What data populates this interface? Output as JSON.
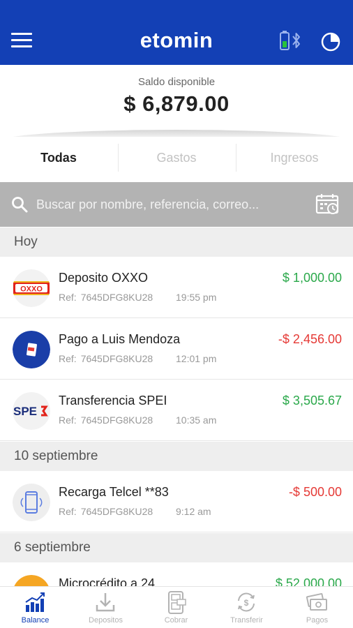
{
  "app": {
    "logo_text": "etomin"
  },
  "balance": {
    "label": "Saldo disponible",
    "value": "$ 6,879.00"
  },
  "tabs": [
    {
      "label": "Todas",
      "active": true
    },
    {
      "label": "Gastos",
      "active": false
    },
    {
      "label": "Ingresos",
      "active": false
    }
  ],
  "search": {
    "placeholder": "Buscar por nombre, referencia, correo..."
  },
  "sections": [
    {
      "header": "Hoy",
      "transactions": [
        {
          "name": "Deposito OXXO",
          "ref_label": "Ref:",
          "ref": "7645DFG8KU28",
          "time": "19:55 pm",
          "amount": "$ 1,000.00",
          "type": "positive",
          "icon": "oxxo-logo"
        },
        {
          "name": "Pago a Luis Mendoza",
          "ref_label": "Ref:",
          "ref": "7645DFG8KU28",
          "time": "12:01 pm",
          "amount": "-$ 2,456.00",
          "type": "negative",
          "icon": "card-icon"
        },
        {
          "name": "Transferencia SPEI",
          "ref_label": "Ref:",
          "ref": "7645DFG8KU28",
          "time": "10:35 am",
          "amount": "$ 3,505.67",
          "type": "positive",
          "icon": "spei-logo"
        }
      ]
    },
    {
      "header": "10 septiembre",
      "transactions": [
        {
          "name": "Recarga Telcel  **83",
          "ref_label": "Ref:",
          "ref": "7645DFG8KU28",
          "time": "9:12 am",
          "amount": "-$ 500.00",
          "type": "negative",
          "icon": "phone-icon"
        }
      ]
    },
    {
      "header": "6 septiembre",
      "transactions": [
        {
          "name": "Microcrédito a 24",
          "amount": "$ 52,000.00",
          "type": "positive",
          "icon": "coin-icon"
        }
      ]
    }
  ],
  "bottom_nav": [
    {
      "label": "Balance",
      "icon": "chart-icon",
      "active": true
    },
    {
      "label": "Depositos",
      "icon": "download-icon",
      "active": false
    },
    {
      "label": "Cobrar",
      "icon": "pos-terminal-icon",
      "active": false
    },
    {
      "label": "Transferir",
      "icon": "transfer-icon",
      "active": false
    },
    {
      "label": "Pagos",
      "icon": "cash-icon",
      "active": false
    }
  ],
  "colors": {
    "primary": "#1340b5",
    "positive": "#2aa84a",
    "negative": "#e53935",
    "search_bar": "#b3b3b3",
    "section_bg": "#eeeeee"
  }
}
